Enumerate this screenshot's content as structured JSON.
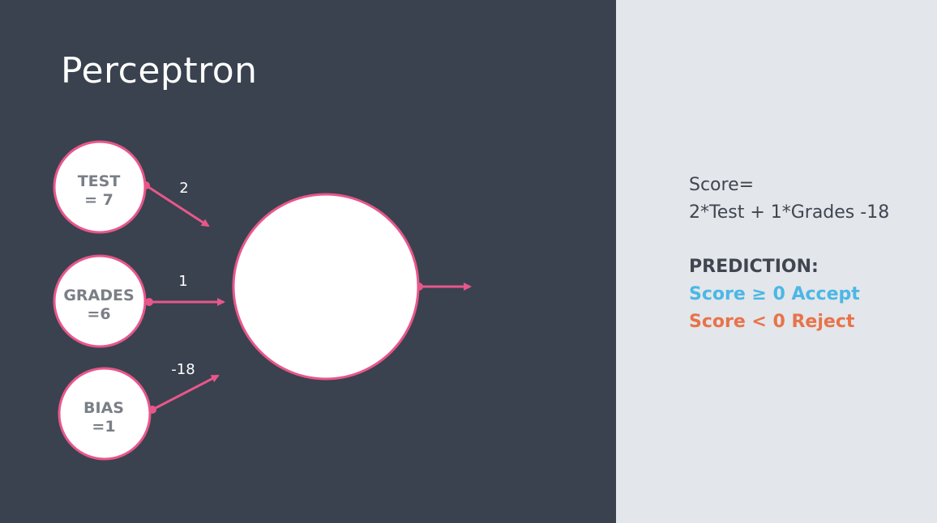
{
  "slide": {
    "title": "Perceptron"
  },
  "inputs": [
    {
      "id": "test",
      "label_line1": "TEST",
      "label_line2": "= 7",
      "weight": "2"
    },
    {
      "id": "grades",
      "label_line1": "GRADES",
      "label_line2": "=6",
      "weight": "1"
    },
    {
      "id": "bias",
      "label_line1": "BIAS",
      "label_line2": "=1",
      "weight": "-18"
    }
  ],
  "panel": {
    "score_label": "Score=",
    "score_formula": "2*Test + 1*Grades -18",
    "prediction_heading": "PREDICTION:",
    "accept_rule": "Score ≥ 0 Accept",
    "reject_rule": "Score < 0 Reject"
  },
  "colors": {
    "left_background": "#39424e",
    "right_background": "#e3e6ea",
    "edge": "#e8578a",
    "accept": "#4bb7e6",
    "reject": "#e8734a"
  }
}
